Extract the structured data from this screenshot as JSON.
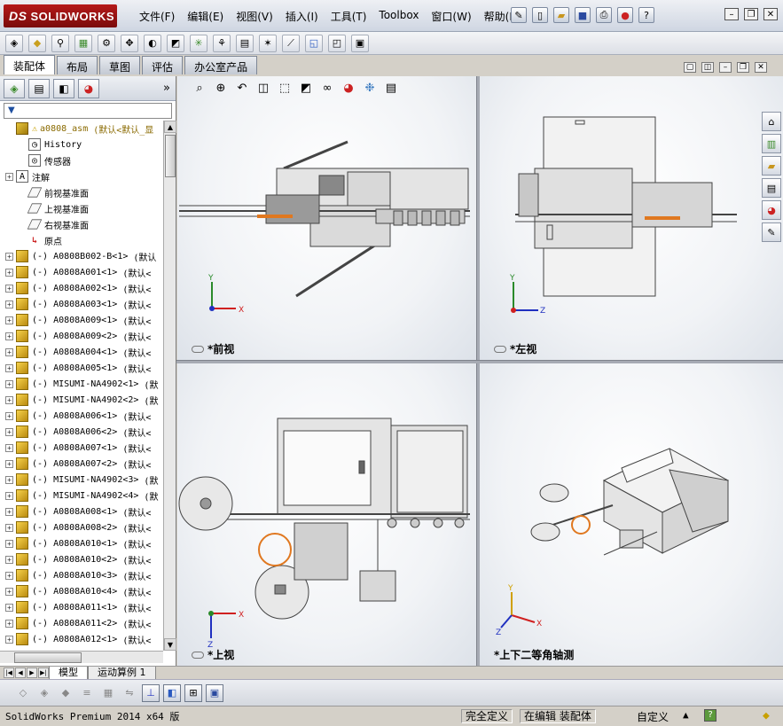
{
  "app": {
    "logo_text": "SOLIDWORKS",
    "logo_prefix": "DS"
  },
  "menu": [
    "文件(F)",
    "编辑(E)",
    "视图(V)",
    "插入(I)",
    "工具(T)",
    "Toolbox",
    "窗口(W)",
    "帮助(H)"
  ],
  "command_tabs": [
    "装配体",
    "布局",
    "草图",
    "评估",
    "办公室产品"
  ],
  "active_command_tab": "装配体",
  "filter_icon": "filter-icon",
  "tree": {
    "root": {
      "label": "a0808_asm",
      "config": "(默认<默认_显"
    },
    "fixed_items": [
      {
        "label": "History",
        "icon": "history-icon"
      },
      {
        "label": "传感器",
        "icon": "sensor-icon"
      },
      {
        "label": "注解",
        "icon": "annotation-icon"
      },
      {
        "label": "前视基准面",
        "icon": "plane-icon"
      },
      {
        "label": "上视基准面",
        "icon": "plane-icon"
      },
      {
        "label": "右视基准面",
        "icon": "plane-icon"
      },
      {
        "label": "原点",
        "icon": "origin-icon"
      }
    ],
    "components": [
      {
        "label": "(-) A0808B002-B<1>",
        "config": "(默认"
      },
      {
        "label": "(-) A0808A001<1>",
        "config": "(默认<"
      },
      {
        "label": "(-) A0808A002<1>",
        "config": "(默认<"
      },
      {
        "label": "(-) A0808A003<1>",
        "config": "(默认<"
      },
      {
        "label": "(-) A0808A009<1>",
        "config": "(默认<"
      },
      {
        "label": "(-) A0808A009<2>",
        "config": "(默认<"
      },
      {
        "label": "(-) A0808A004<1>",
        "config": "(默认<"
      },
      {
        "label": "(-) A0808A005<1>",
        "config": "(默认<"
      },
      {
        "label": "(-) MISUMI-NA4902<1>",
        "config": "(默"
      },
      {
        "label": "(-) MISUMI-NA4902<2>",
        "config": "(默"
      },
      {
        "label": "(-) A0808A006<1>",
        "config": "(默认<"
      },
      {
        "label": "(-) A0808A006<2>",
        "config": "(默认<"
      },
      {
        "label": "(-) A0808A007<1>",
        "config": "(默认<"
      },
      {
        "label": "(-) A0808A007<2>",
        "config": "(默认<"
      },
      {
        "label": "(-) MISUMI-NA4902<3>",
        "config": "(默"
      },
      {
        "label": "(-) MISUMI-NA4902<4>",
        "config": "(默"
      },
      {
        "label": "(-) A0808A008<1>",
        "config": "(默认<"
      },
      {
        "label": "(-) A0808A008<2>",
        "config": "(默认<"
      },
      {
        "label": "(-) A0808A010<1>",
        "config": "(默认<"
      },
      {
        "label": "(-) A0808A010<2>",
        "config": "(默认<"
      },
      {
        "label": "(-) A0808A010<3>",
        "config": "(默认<"
      },
      {
        "label": "(-) A0808A010<4>",
        "config": "(默认<"
      },
      {
        "label": "(-) A0808A011<1>",
        "config": "(默认<"
      },
      {
        "label": "(-) A0808A011<2>",
        "config": "(默认<"
      },
      {
        "label": "(-) A0808A012<1>",
        "config": "(默认<"
      }
    ]
  },
  "viewports": {
    "front": {
      "label": "*前视",
      "axis_h": "X",
      "axis_v": "Y"
    },
    "left": {
      "label": "*左视",
      "axis_h": "Z",
      "axis_v": "Y"
    },
    "top": {
      "label": "*上视",
      "axis_h": "X",
      "axis_v": "Z"
    },
    "iso": {
      "label": "*上下二等角轴测",
      "axis_1": "X",
      "axis_2": "Y",
      "axis_3": "Z"
    }
  },
  "bottom_tabs": [
    "模型",
    "运动算例 1"
  ],
  "active_bottom_tab": "模型",
  "status": {
    "product": "SolidWorks Premium 2014 x64 版",
    "definition": "完全定义",
    "editing": "在编辑 装配体",
    "units": "自定义",
    "help": "?"
  },
  "colors": {
    "accent_orange": "#e07820",
    "brand_red": "#9b1212",
    "axis_red": "#d02020",
    "axis_green": "#2a8a2a",
    "axis_blue": "#2030c0"
  }
}
